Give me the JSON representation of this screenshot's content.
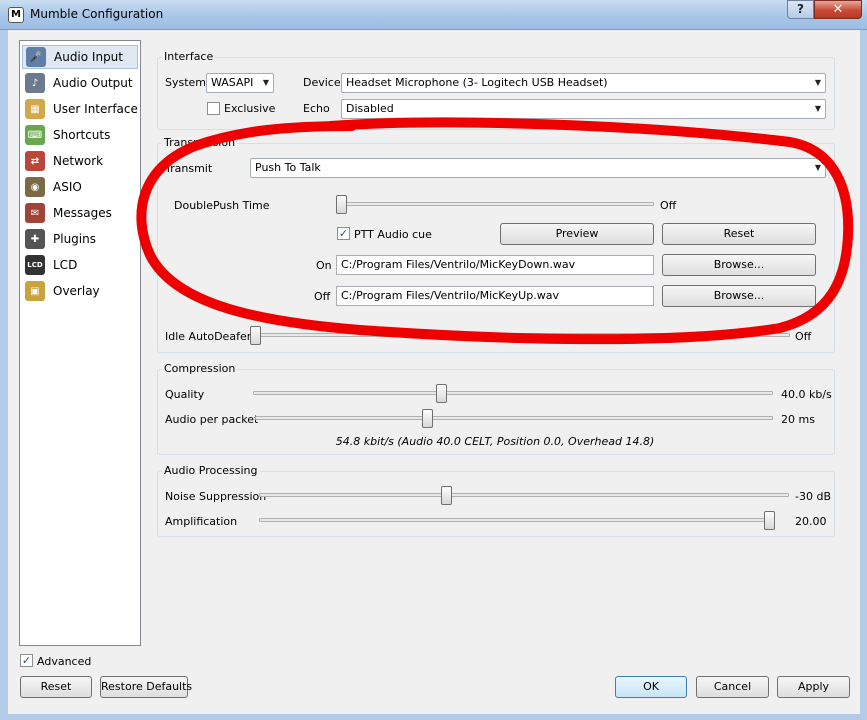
{
  "window": {
    "title": "Mumble Configuration",
    "help_glyph": "?",
    "close_glyph": "✕",
    "icon_glyph": "M"
  },
  "sidebar": {
    "items": [
      {
        "label": "Audio Input",
        "icon": "microphone-icon",
        "selected": true
      },
      {
        "label": "Audio Output",
        "icon": "speaker-icon"
      },
      {
        "label": "User Interface",
        "icon": "ui-icon"
      },
      {
        "label": "Shortcuts",
        "icon": "shortcuts-icon"
      },
      {
        "label": "Network",
        "icon": "network-icon"
      },
      {
        "label": "ASIO",
        "icon": "asio-icon"
      },
      {
        "label": "Messages",
        "icon": "messages-icon"
      },
      {
        "label": "Plugins",
        "icon": "plugins-icon"
      },
      {
        "label": "LCD",
        "icon": "lcd-icon"
      },
      {
        "label": "Overlay",
        "icon": "overlay-icon"
      }
    ]
  },
  "interface": {
    "title": "Interface",
    "system_label": "System",
    "system_value": "WASAPI",
    "device_label": "Device",
    "device_value": "Headset Microphone (3- Logitech USB Headset)",
    "exclusive_label": "Exclusive",
    "exclusive_checked": false,
    "echo_label": "Echo",
    "echo_value": "Disabled"
  },
  "transmission": {
    "title": "Transmission",
    "transmit_label": "Transmit",
    "transmit_value": "Push To Talk",
    "doublepush_label": "DoublePush Time",
    "doublepush_value": "Off",
    "doublepush_level": 0.0,
    "ptt_cue_label": "PTT Audio cue",
    "ptt_cue_checked": true,
    "preview_label": "Preview",
    "reset_label": "Reset",
    "on_label": "On",
    "on_path": "C:/Program Files/Ventrilo/MicKeyDown.wav",
    "off_label": "Off",
    "off_path": "C:/Program Files/Ventrilo/MicKeyUp.wav",
    "browse_label": "Browse...",
    "idle_label": "Idle AutoDeafen",
    "idle_value": "Off",
    "idle_level": 0.0
  },
  "compression": {
    "title": "Compression",
    "quality_label": "Quality",
    "quality_value": "40.0 kb/s",
    "quality_level": 0.36,
    "packet_label": "Audio per packet",
    "packet_value": "20 ms",
    "packet_level": 0.33,
    "summary": "54.8 kbit/s (Audio 40.0 CELT, Position 0.0, Overhead 14.8)"
  },
  "processing": {
    "title": "Audio Processing",
    "noise_label": "Noise Suppression",
    "noise_value": "-30 dB",
    "noise_level": 0.35,
    "amp_label": "Amplification",
    "amp_value": "20.00",
    "amp_level": 1.0
  },
  "footer": {
    "advanced_label": "Advanced",
    "advanced_checked": true,
    "reset_label": "Reset",
    "restore_label": "Restore Defaults",
    "ok_label": "OK",
    "cancel_label": "Cancel",
    "apply_label": "Apply"
  },
  "colors": {
    "annotation_red": "#ee0000",
    "selection": "#dfe8f3",
    "title_bar": "#a9c6e8"
  }
}
